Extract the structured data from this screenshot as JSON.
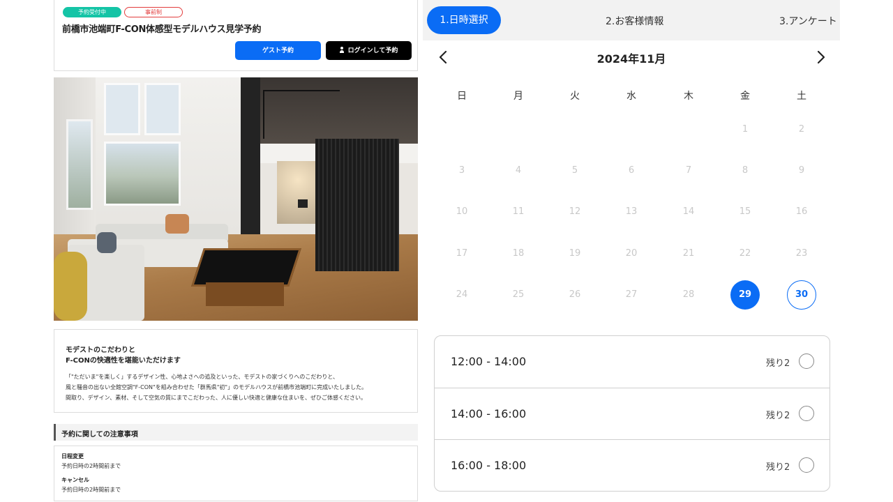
{
  "event": {
    "badge_open": "予約受付中",
    "badge_pre": "事前制",
    "title": "前橋市池端町F-CON体感型モデルハウス見学予約",
    "guest_button": "ゲスト予約",
    "login_button": "ログインして予約"
  },
  "intro": {
    "heading_1": "モデストのこだわりと",
    "heading_2": "F-CONの快適性を堪能いただけます",
    "lines": [
      "「\"ただいま\"を楽しく」するデザイン性、心地よさへの追及といった、モデストの家づくりへのこだわりと、",
      "風と騒音の出ない全館空調\"F-CON\"を組み合わせた「群馬県\"初\"」のモデルハウスが前橋市池端町に完成いたしました。",
      "間取り、デザイン、素材、そして空気の質にまでこだわった、人に優しい快適と健康な住まいを、ぜひご体感ください。"
    ]
  },
  "notes": {
    "heading": "予約に関しての注意事項",
    "items": [
      {
        "label": "日程変更",
        "value": "予約日時の2時間前まで"
      },
      {
        "label": "キャンセル",
        "value": "予約日時の2時間前まで"
      }
    ]
  },
  "steps": [
    "1.日時選択",
    "2.お客様情報",
    "3.アンケート"
  ],
  "calendar": {
    "month_label": "2024年11月",
    "weekdays": [
      "日",
      "月",
      "火",
      "水",
      "木",
      "金",
      "土"
    ],
    "selected_day": "29",
    "available_days": [
      "30"
    ],
    "weeks": [
      [
        "",
        "",
        "",
        "",
        "",
        "1",
        "2"
      ],
      [
        "3",
        "4",
        "5",
        "6",
        "7",
        "8",
        "9"
      ],
      [
        "10",
        "11",
        "12",
        "13",
        "14",
        "15",
        "16"
      ],
      [
        "17",
        "18",
        "19",
        "20",
        "21",
        "22",
        "23"
      ],
      [
        "24",
        "25",
        "26",
        "27",
        "28",
        "29",
        "30"
      ]
    ]
  },
  "slots": [
    {
      "time": "12:00 - 14:00",
      "remain": "残り2"
    },
    {
      "time": "14:00 - 16:00",
      "remain": "残り2"
    },
    {
      "time": "16:00 - 18:00",
      "remain": "残り2"
    }
  ],
  "colors": {
    "accent": "#0a6cf5",
    "badge_open": "#14c4a6",
    "badge_pre": "#e23b3b",
    "disabled_day": "#c8c8c8"
  }
}
